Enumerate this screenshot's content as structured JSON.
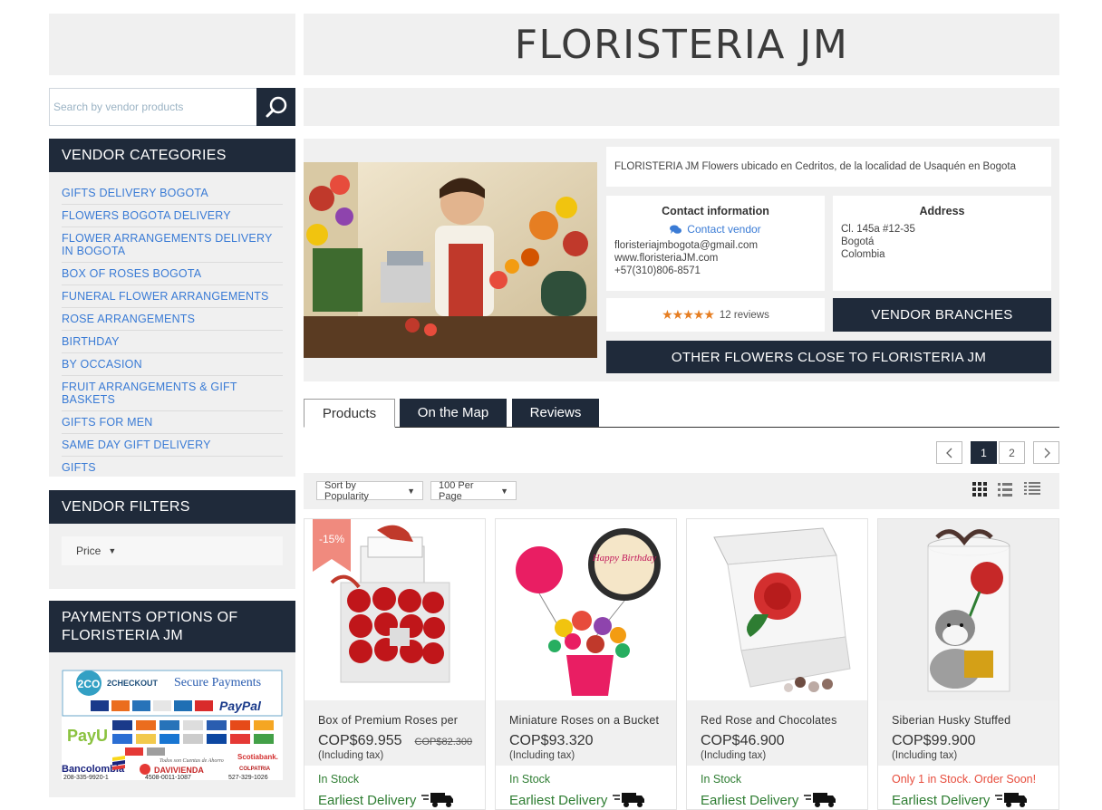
{
  "header": {
    "title": "FLORISTERIA JM"
  },
  "search": {
    "placeholder": "Search by vendor products"
  },
  "categories": {
    "heading": "VENDOR CATEGORIES",
    "items": [
      "GIFTS DELIVERY BOGOTA",
      "FLOWERS BOGOTA DELIVERY",
      "FLOWER ARRANGEMENTS DELIVERY IN BOGOTA",
      "BOX OF ROSES BOGOTA",
      "FUNERAL FLOWER ARRANGEMENTS",
      "ROSE ARRANGEMENTS",
      "BIRTHDAY",
      "BY OCCASION",
      "FRUIT ARRANGEMENTS & GIFT BASKETS",
      "GIFTS FOR MEN",
      "SAME DAY GIFT DELIVERY",
      "GIFTS"
    ]
  },
  "filters": {
    "heading": "VENDOR FILTERS",
    "price_label": "Price"
  },
  "payments": {
    "heading": "PAYMENTS OPTIONS OF FLORISTERIA JM",
    "badge_2co": "2CO",
    "checkout_label": "2CHECKOUT",
    "secure_label": "Secure Payments",
    "paypal_label": "PayPal",
    "payu_label": "PayU",
    "bank_label": "Bancolombia",
    "bank_note": "Todos son Cuentas de Ahorro",
    "scotiabank_label": "Scotiabank.",
    "davivienda_label": "DAVIVIENDA",
    "colpatria_label": "COLPATRIA",
    "account_1": "208-335-9920-1",
    "account_2": "4508-0011-1087",
    "account_3": "527-329-1026"
  },
  "vendor": {
    "description": "FLORISTERIA JM Flowers ubicado en Cedritos, de la localidad de Usaquén en Bogota",
    "contact": {
      "title": "Contact information",
      "link": "Contact vendor",
      "email": "floristeriajmbogota@gmail.com",
      "website": "www.floristeriaJM.com",
      "phone": "+57(310)806-8571"
    },
    "address": {
      "title": "Address",
      "line1": "Cl. 145a #12-35",
      "line2": "Bogotá",
      "line3": "Colombia"
    },
    "rating": {
      "stars": 5,
      "reviews": "12 reviews"
    },
    "branches_button": "VENDOR BRANCHES",
    "other_button": "OTHER FLOWERS CLOSE TO FLORISTERIA JM"
  },
  "tabs": [
    "Products",
    "On the Map",
    "Reviews"
  ],
  "pagination": {
    "pages": [
      "1",
      "2"
    ],
    "current": "1"
  },
  "toolbar": {
    "sort": "Sort by Popularity",
    "per_page": "100 Per Page"
  },
  "products": [
    {
      "name": "Box of Premium Roses per",
      "price": "COP$69.955",
      "old_price": "COP$82.300",
      "tax": "(Including tax)",
      "stock": "In Stock",
      "delivery": "Earliest Delivery",
      "badge": "-15%"
    },
    {
      "name": "Miniature Roses on a Bucket",
      "price": "COP$93.320",
      "tax": "(Including tax)",
      "stock": "In Stock",
      "delivery": "Earliest Delivery",
      "balloon_text": "Happy Birthday"
    },
    {
      "name": "Red Rose and Chocolates",
      "price": "COP$46.900",
      "tax": "(Including tax)",
      "stock": "In Stock",
      "delivery": "Earliest Delivery"
    },
    {
      "name": "Siberian Husky Stuffed",
      "price": "COP$99.900",
      "tax": "(Including tax)",
      "stock": "Only 1 in Stock. Order Soon!",
      "delivery": "Earliest Delivery"
    }
  ],
  "colors": {
    "navy": "#1f2a3a",
    "link_blue": "#3a7bd5",
    "star_orange": "#e67e22",
    "stock_green": "#2e7d32",
    "warn_red": "#e74c3c",
    "badge_salmon": "#f08a7e"
  }
}
